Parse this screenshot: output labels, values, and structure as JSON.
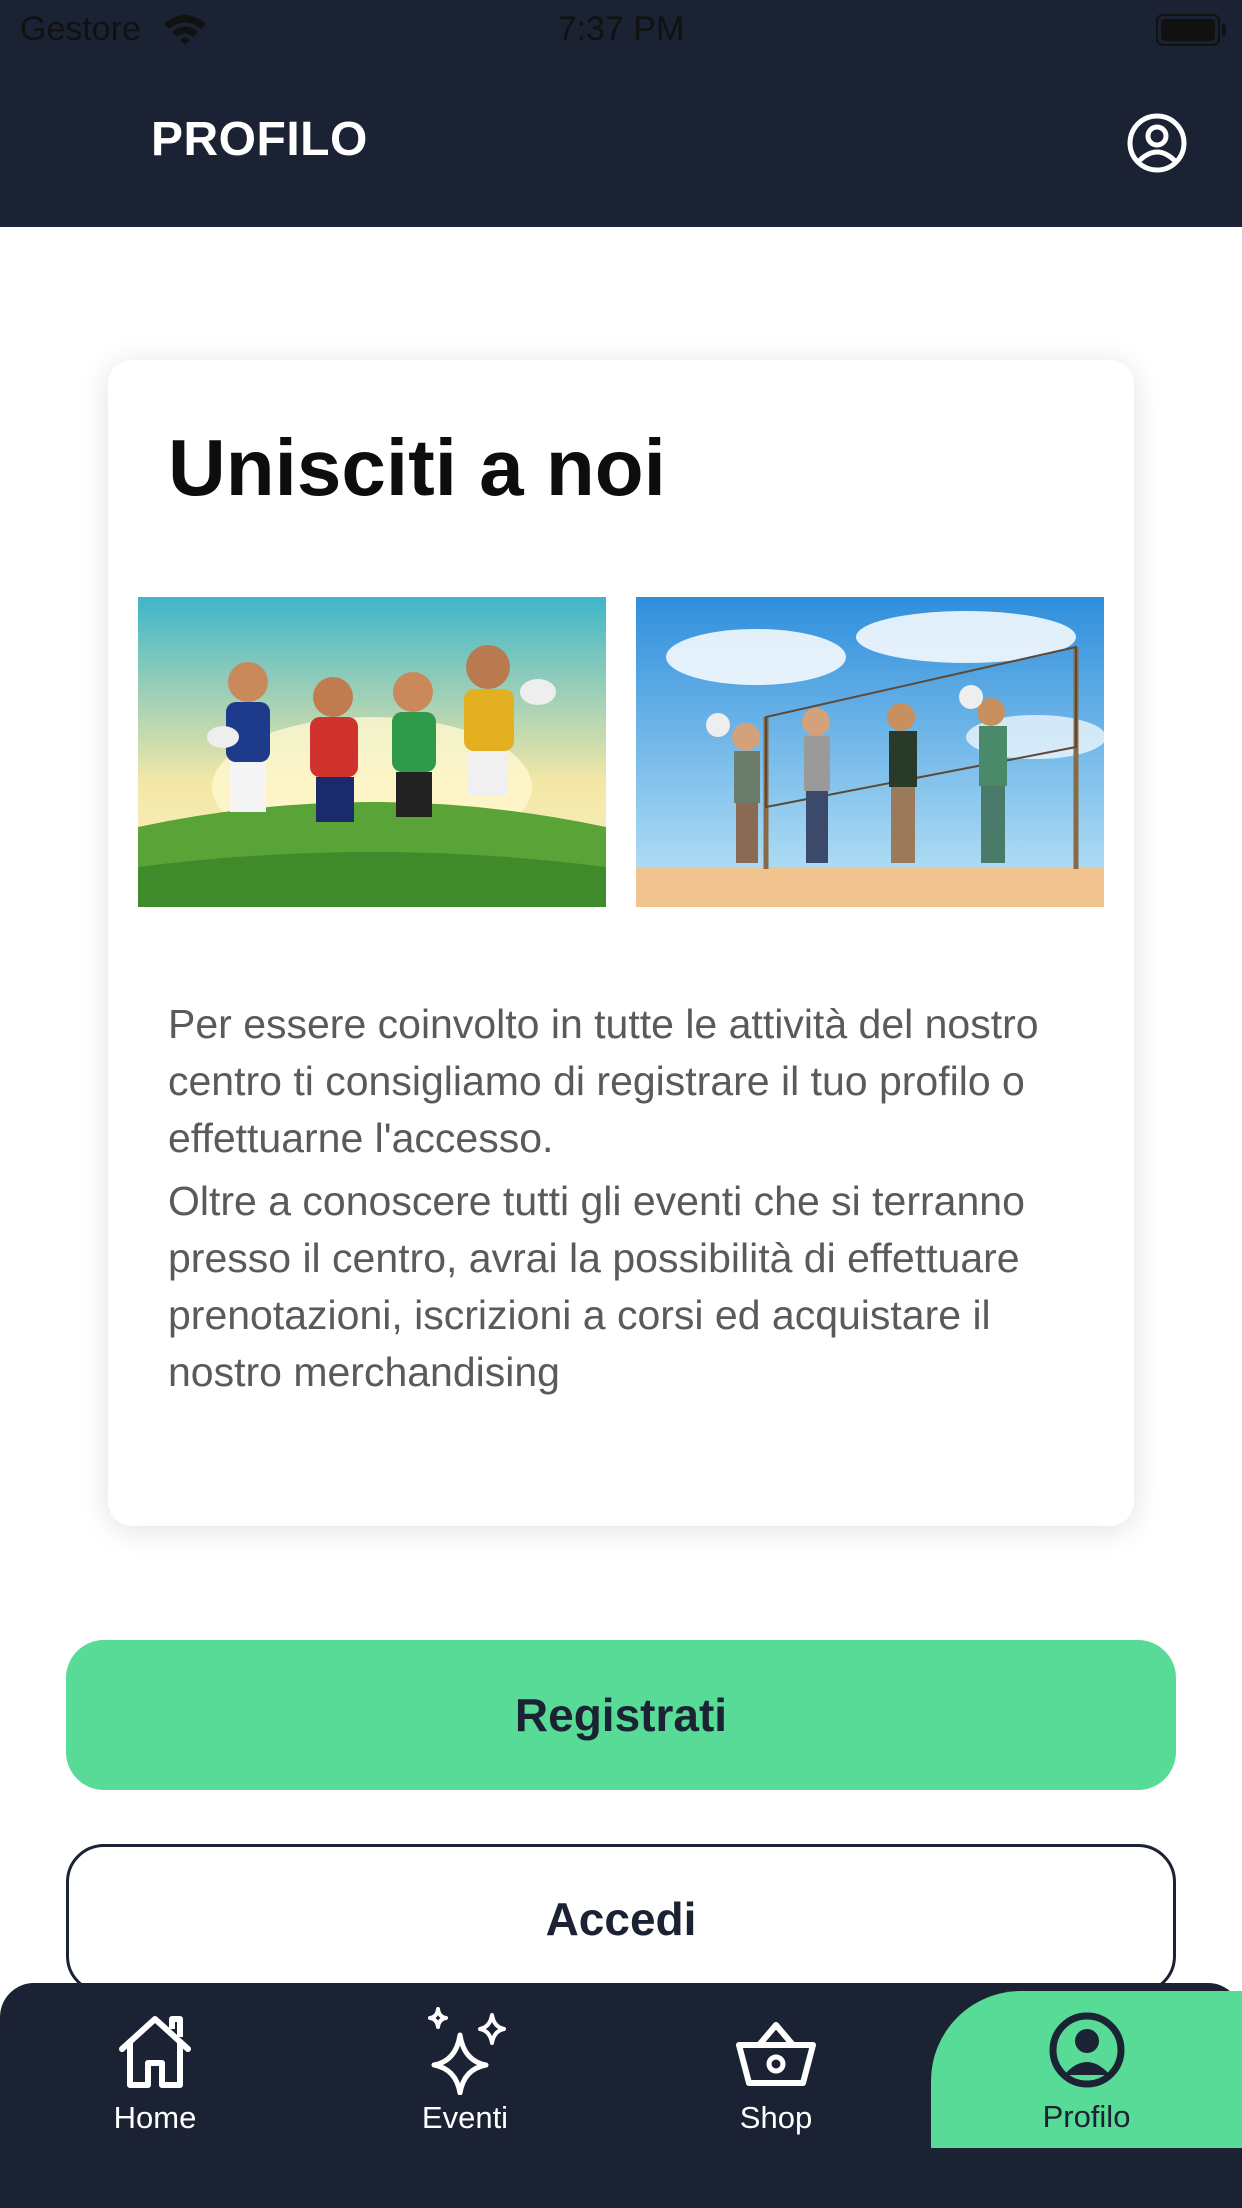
{
  "status_bar": {
    "carrier": "Gestore",
    "time": "7:37 PM"
  },
  "header": {
    "title": "PROFILO",
    "profile_icon": "account-circle-icon"
  },
  "card": {
    "title": "Unisciti a noi",
    "images": [
      "rugby-players-illustration",
      "beach-volley-players-illustration"
    ],
    "paragraph1": "Per essere coinvolto in tutte le attività del nostro centro ti consigliamo di registrare il tuo profilo o effettuarne l'accesso.",
    "paragraph2": "Oltre a conoscere tutti gli eventi che si terranno presso il centro, avrai la possibilità di effettuare prenotazioni, iscrizioni a corsi ed acquistare il nostro merchandising"
  },
  "buttons": {
    "register": "Registrati",
    "login": "Accedi"
  },
  "tabbar": {
    "items": [
      {
        "label": "Home",
        "icon": "home-icon"
      },
      {
        "label": "Eventi",
        "icon": "sparkles-icon"
      },
      {
        "label": "Shop",
        "icon": "basket-icon"
      },
      {
        "label": "Profilo",
        "icon": "account-circle-icon",
        "active": true
      }
    ]
  },
  "colors": {
    "navy": "#1b2233",
    "accent": "#57db96",
    "text_gray": "#5a5a5a"
  }
}
